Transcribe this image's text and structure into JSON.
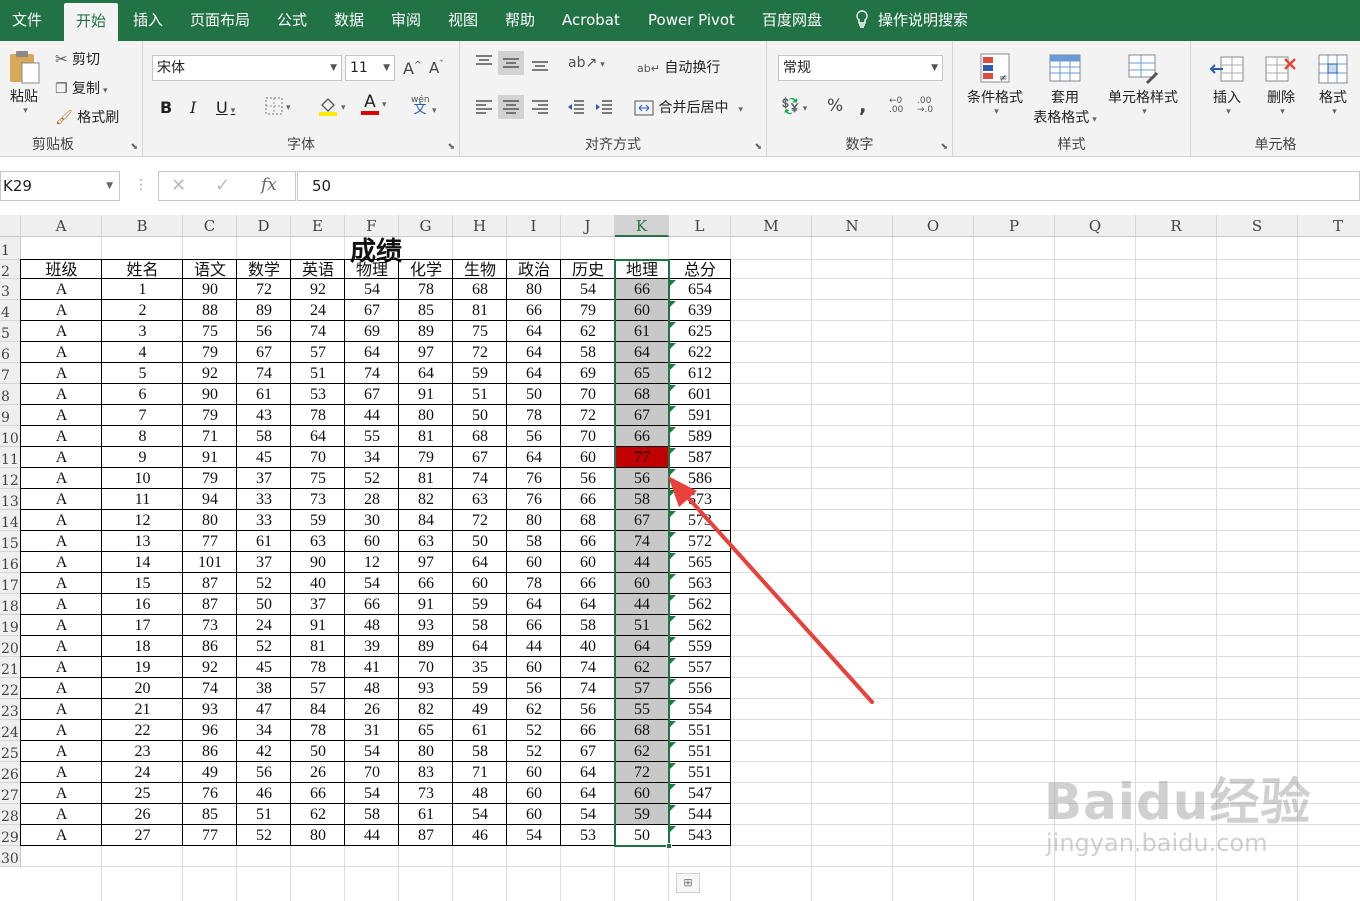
{
  "menu": {
    "tabs": [
      "文件",
      "开始",
      "插入",
      "页面布局",
      "公式",
      "数据",
      "审阅",
      "视图",
      "帮助",
      "Acrobat",
      "Power Pivot",
      "百度网盘",
      "操作说明搜索"
    ],
    "active": "开始"
  },
  "ribbon": {
    "clipboard": {
      "label": "剪贴板",
      "paste": "粘贴",
      "cut": "剪切",
      "copy": "复制",
      "format_painter": "格式刷"
    },
    "font": {
      "label": "字体",
      "name": "宋体",
      "size": "11",
      "grow": "A",
      "shrink": "A",
      "bold": "B",
      "italic": "I",
      "underline": "U",
      "fontcolor_letter": "A",
      "phonetic": "wén"
    },
    "alignment": {
      "label": "对齐方式",
      "wrap": "自动换行",
      "merge": "合并后居中"
    },
    "number": {
      "label": "数字",
      "format": "常规",
      "percent": "%",
      "comma": ","
    },
    "styles": {
      "label": "样式",
      "conditional": "条件格式",
      "table_l1": "套用",
      "table_l2": "表格格式",
      "cell_styles": "单元格样式"
    },
    "cells": {
      "label": "单元格",
      "insert": "插入",
      "delete": "删除",
      "format": "格式"
    }
  },
  "formula_bar": {
    "name_box": "K29",
    "fx": "fx",
    "value": "50"
  },
  "sheet": {
    "columns": [
      "A",
      "B",
      "C",
      "D",
      "E",
      "F",
      "G",
      "H",
      "I",
      "J",
      "K",
      "L",
      "M",
      "N",
      "O",
      "P",
      "Q",
      "R",
      "S",
      "T"
    ],
    "selected_column": "K",
    "title": "成绩",
    "headers": [
      "班级",
      "姓名",
      "语文",
      "数学",
      "英语",
      "物理",
      "化学",
      "生物",
      "政治",
      "历史",
      "地理",
      "总分"
    ],
    "rows": [
      [
        "A",
        "1",
        "90",
        "72",
        "92",
        "54",
        "78",
        "68",
        "80",
        "54",
        "66",
        "654"
      ],
      [
        "A",
        "2",
        "88",
        "89",
        "24",
        "67",
        "85",
        "81",
        "66",
        "79",
        "60",
        "639"
      ],
      [
        "A",
        "3",
        "75",
        "56",
        "74",
        "69",
        "89",
        "75",
        "64",
        "62",
        "61",
        "625"
      ],
      [
        "A",
        "4",
        "79",
        "67",
        "57",
        "64",
        "97",
        "72",
        "64",
        "58",
        "64",
        "622"
      ],
      [
        "A",
        "5",
        "92",
        "74",
        "51",
        "74",
        "64",
        "59",
        "64",
        "69",
        "65",
        "612"
      ],
      [
        "A",
        "6",
        "90",
        "61",
        "53",
        "67",
        "91",
        "51",
        "50",
        "70",
        "68",
        "601"
      ],
      [
        "A",
        "7",
        "79",
        "43",
        "78",
        "44",
        "80",
        "50",
        "78",
        "72",
        "67",
        "591"
      ],
      [
        "A",
        "8",
        "71",
        "58",
        "64",
        "55",
        "81",
        "68",
        "56",
        "70",
        "66",
        "589"
      ],
      [
        "A",
        "9",
        "91",
        "45",
        "70",
        "34",
        "79",
        "67",
        "64",
        "60",
        "77",
        "587"
      ],
      [
        "A",
        "10",
        "79",
        "37",
        "75",
        "52",
        "81",
        "74",
        "76",
        "56",
        "56",
        "586"
      ],
      [
        "A",
        "11",
        "94",
        "33",
        "73",
        "28",
        "82",
        "63",
        "76",
        "66",
        "58",
        "573"
      ],
      [
        "A",
        "12",
        "80",
        "33",
        "59",
        "30",
        "84",
        "72",
        "80",
        "68",
        "67",
        "573"
      ],
      [
        "A",
        "13",
        "77",
        "61",
        "63",
        "60",
        "63",
        "50",
        "58",
        "66",
        "74",
        "572"
      ],
      [
        "A",
        "14",
        "101",
        "37",
        "90",
        "12",
        "97",
        "64",
        "60",
        "60",
        "44",
        "565"
      ],
      [
        "A",
        "15",
        "87",
        "52",
        "40",
        "54",
        "66",
        "60",
        "78",
        "66",
        "60",
        "563"
      ],
      [
        "A",
        "16",
        "87",
        "50",
        "37",
        "66",
        "91",
        "59",
        "64",
        "64",
        "44",
        "562"
      ],
      [
        "A",
        "17",
        "73",
        "24",
        "91",
        "48",
        "93",
        "58",
        "66",
        "58",
        "51",
        "562"
      ],
      [
        "A",
        "18",
        "86",
        "52",
        "81",
        "39",
        "89",
        "64",
        "44",
        "40",
        "64",
        "559"
      ],
      [
        "A",
        "19",
        "92",
        "45",
        "78",
        "41",
        "70",
        "35",
        "60",
        "74",
        "62",
        "557"
      ],
      [
        "A",
        "20",
        "74",
        "38",
        "57",
        "48",
        "93",
        "59",
        "56",
        "74",
        "57",
        "556"
      ],
      [
        "A",
        "21",
        "93",
        "47",
        "84",
        "26",
        "82",
        "49",
        "62",
        "56",
        "55",
        "554"
      ],
      [
        "A",
        "22",
        "96",
        "34",
        "78",
        "31",
        "65",
        "61",
        "52",
        "66",
        "68",
        "551"
      ],
      [
        "A",
        "23",
        "86",
        "42",
        "50",
        "54",
        "80",
        "58",
        "52",
        "67",
        "62",
        "551"
      ],
      [
        "A",
        "24",
        "49",
        "56",
        "26",
        "70",
        "83",
        "71",
        "60",
        "64",
        "72",
        "551"
      ],
      [
        "A",
        "25",
        "76",
        "46",
        "66",
        "54",
        "73",
        "48",
        "60",
        "64",
        "60",
        "547"
      ],
      [
        "A",
        "26",
        "85",
        "51",
        "62",
        "58",
        "61",
        "54",
        "60",
        "54",
        "59",
        "544"
      ],
      [
        "A",
        "27",
        "77",
        "52",
        "80",
        "44",
        "87",
        "46",
        "54",
        "53",
        "50",
        "543"
      ]
    ],
    "highlight": {
      "row_index": 8,
      "col_index": 10,
      "color": "#c00000"
    },
    "selected_fill": "#c8c8c8",
    "arrow_color": "#e8413c"
  },
  "watermark": {
    "brand": "Baidu经验",
    "url": "jingyan.baidu.com"
  },
  "colors": {
    "excel_green": "#217346",
    "ribbon_bg": "#f3f3f3"
  }
}
